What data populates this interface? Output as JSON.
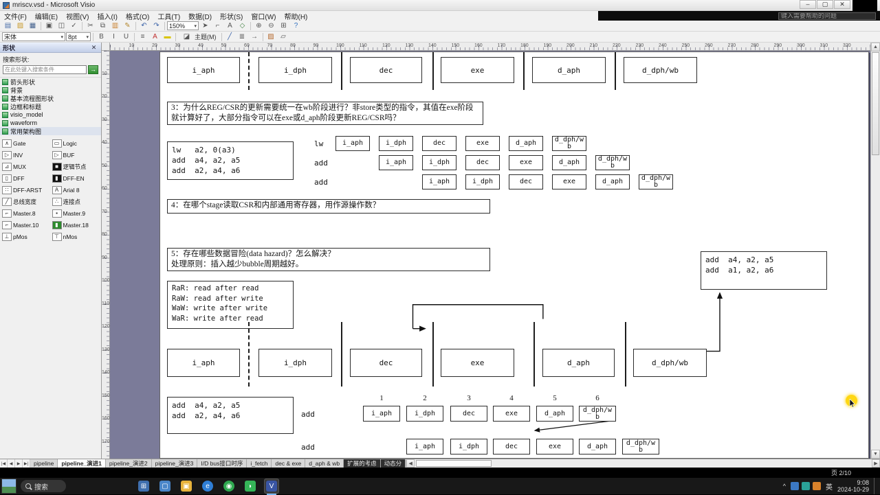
{
  "window": {
    "title": "mriscv.vsd - Microsoft Visio",
    "minimize": "–",
    "maximize": "▢",
    "close": "✕"
  },
  "menu_bar": {
    "items": [
      "文件(F)",
      "编辑(E)",
      "视图(V)",
      "插入(I)",
      "格式(O)",
      "工具(T)",
      "数据(D)",
      "形状(S)",
      "窗口(W)",
      "帮助(H)"
    ],
    "help_search": "键入需要帮助的问题"
  },
  "toolbars": {
    "zoom": "150%",
    "font_name": "宋体",
    "font_size": "8pt",
    "row1_icons": [
      {
        "n": "new-document-icon",
        "g": "▤",
        "c": "#4a6ea9"
      },
      {
        "n": "open-folder-icon",
        "g": "▨",
        "c": "#c99b2f"
      },
      {
        "n": "save-icon",
        "g": "▦",
        "c": "#44628e"
      },
      {
        "n": "print-icon",
        "g": "▣"
      },
      {
        "n": "print-preview-icon",
        "g": "◫"
      },
      {
        "n": "spelling-icon",
        "g": "✓"
      },
      {
        "n": "cut-icon",
        "g": "✂"
      },
      {
        "n": "copy-icon",
        "g": "⧉"
      },
      {
        "n": "paste-icon",
        "g": "▥",
        "c": "#c9812f"
      },
      {
        "n": "format-painter-icon",
        "g": "✎",
        "c": "#b3862c"
      },
      {
        "n": "undo-icon",
        "g": "↶",
        "c": "#3a62a8"
      },
      {
        "n": "redo-icon",
        "g": "↷",
        "c": "#3a62a8"
      },
      {
        "n": "zoom-level-select",
        "select": "zoom"
      },
      {
        "n": "pointer-tool-icon",
        "g": "➤"
      },
      {
        "n": "connector-tool-icon",
        "g": "⌐"
      },
      {
        "n": "text-tool-icon",
        "g": "A"
      },
      {
        "n": "drawing-tools-icon",
        "g": "◇",
        "c": "#3f7f3f"
      },
      {
        "n": "zoom-in-icon",
        "g": "⊕"
      },
      {
        "n": "zoom-out-icon",
        "g": "⊖"
      },
      {
        "n": "pan-icon",
        "g": "⊞"
      },
      {
        "n": "help-icon",
        "g": "?",
        "c": "#2f6fbf"
      }
    ],
    "row2_icons": [
      {
        "n": "bold-icon",
        "g": "B"
      },
      {
        "n": "italic-icon",
        "g": "I"
      },
      {
        "n": "underline-icon",
        "g": "U"
      },
      {
        "n": "align-left-icon",
        "g": "≡"
      },
      {
        "n": "font-color-icon",
        "g": "A",
        "c": "#c03030"
      },
      {
        "n": "highlighter-icon",
        "g": "▬",
        "c": "#d9c400"
      },
      {
        "n": "theme-button",
        "text": "主题(M)"
      },
      {
        "n": "line-color-icon",
        "g": "╱",
        "c": "#3a62a8"
      },
      {
        "n": "line-weight-icon",
        "g": "≣"
      },
      {
        "n": "arrow-ends-icon",
        "g": "→"
      },
      {
        "n": "fill-color-icon",
        "g": "▨",
        "c": "#b56a2f"
      },
      {
        "n": "shadow-icon",
        "g": "▱"
      }
    ]
  },
  "shapes_panel": {
    "title": "形状",
    "close": "✕",
    "search_label": "搜索形状:",
    "search_placeholder": "在此处键入搜索条件",
    "search_go": "→",
    "categories": [
      {
        "label": "箭头形状"
      },
      {
        "label": "背景"
      },
      {
        "label": "基本流程图形状"
      },
      {
        "label": "边框和标题"
      },
      {
        "label": "visio_model"
      },
      {
        "label": "waveform"
      },
      {
        "label": "常用架构图",
        "open": true
      }
    ],
    "stencil_items": [
      {
        "label": "Gate",
        "icon": "and-gate-icon",
        "g": "∧"
      },
      {
        "label": "Logic",
        "icon": "logic-block-icon",
        "g": "▭"
      },
      {
        "label": "INV",
        "icon": "inverter-icon",
        "g": "▷"
      },
      {
        "label": "BUF",
        "icon": "buffer-icon",
        "g": "▷"
      },
      {
        "label": "MUX",
        "icon": "mux-icon",
        "g": "⊿"
      },
      {
        "label": "逻辑节点",
        "icon": "logic-node-icon",
        "g": "■",
        "c": "#111"
      },
      {
        "label": "DFF",
        "icon": "dff-icon",
        "g": "▯"
      },
      {
        "label": "DFF-EN",
        "icon": "dff-en-icon",
        "g": "▮",
        "c": "#111"
      },
      {
        "label": "DFF-ARST",
        "icon": "dff-arst-icon",
        "g": "∷"
      },
      {
        "label": "Arial 8",
        "icon": "text-style-icon",
        "g": "A"
      },
      {
        "label": "总线宽度",
        "icon": "bus-width-icon",
        "g": "╱"
      },
      {
        "label": "连接点",
        "icon": "connect-point-icon",
        "g": "∴"
      },
      {
        "label": "Master.8",
        "icon": "master8-icon",
        "g": "⌐"
      },
      {
        "label": "Master.9",
        "icon": "master9-icon",
        "g": "▪"
      },
      {
        "label": "Master.10",
        "icon": "master10-icon",
        "g": "⌐"
      },
      {
        "label": "Master.18",
        "icon": "master18-icon",
        "g": "▮",
        "c": "#2e8b2e"
      },
      {
        "label": "pMos",
        "icon": "pmos-icon",
        "g": "⊥"
      },
      {
        "label": "nMos",
        "icon": "nmos-icon",
        "g": "⊤"
      }
    ]
  },
  "rulers": {
    "start": 10,
    "step": 10,
    "h_count": 32,
    "v_count": 17
  },
  "canvas": {
    "stages": [
      "i_aph",
      "i_dph",
      "dec",
      "exe",
      "d_aph",
      "d_dph/wb"
    ],
    "q3": "3：为什么REG/CSR的更新需要统一在wb阶段进行？非store类型的指令，其值在exe阶段就计算好了，大部分指令可以在exe或d_aph阶段更新REG/CSR吗？",
    "q4": "4：在哪个stage读取CSR和内部通用寄存器，用作源操作数？",
    "q5": "5：存在哪些数据冒险(data hazard)？怎么解决？\n处理原则：插入越少bubble周期越好。",
    "code_lw": "lw   a2, 0(a3)\nadd  a4, a2, a5\nadd  a2, a4, a6",
    "hazards": "RaR: read after read\nRaW: read after write\nWaW: write after write\nWaR: write after read",
    "code_add_right": "add  a4, a2, a5\nadd  a1, a2, a6",
    "code_add_bottom": "add  a4, a2, a5\nadd  a2, a4, a6",
    "pipe1_rows": [
      {
        "label": "lw",
        "start": 0
      },
      {
        "label": "add",
        "start": 1
      },
      {
        "label": "add",
        "start": 2
      }
    ],
    "pipe2_numbers": [
      "1",
      "2",
      "3",
      "4",
      "5",
      "6"
    ],
    "pipe2_rows": [
      {
        "label": "add",
        "start": 0
      },
      {
        "label": "add",
        "start": 1
      }
    ]
  },
  "sheet_tabs": {
    "nav": [
      "|◀",
      "◀",
      "▶",
      "▶|"
    ],
    "tabs": [
      {
        "label": "pipeline"
      },
      {
        "label": "pipeline_演进1",
        "active": true
      },
      {
        "label": "pipeline_演进2"
      },
      {
        "label": "pipeline_演进3"
      },
      {
        "label": "I/D bus接口时序"
      },
      {
        "label": "i_fetch"
      },
      {
        "label": "dec & exe"
      },
      {
        "label": "d_aph & wb"
      },
      {
        "label": "扩展的考虑",
        "dark": true
      },
      {
        "label": "动态分",
        "dark": true
      }
    ]
  },
  "status_bar": {
    "page_indicator": "页 2/10"
  },
  "taskbar": {
    "search_label": "搜索",
    "apps": [
      {
        "n": "task-view-icon",
        "bg": "#3f6fae",
        "g": "⊞"
      },
      {
        "n": "remote-desktop-icon",
        "bg": "#4a86c8",
        "g": "▢"
      },
      {
        "n": "file-explorer-icon",
        "bg": "#e8b33c",
        "g": "▣"
      },
      {
        "n": "edge-browser-icon",
        "bg": "#2f7fd6",
        "g": "e",
        "round": true
      },
      {
        "n": "app-store-icon",
        "bg": "#2fa84f",
        "g": "◉",
        "round": true
      },
      {
        "n": "wechat-icon",
        "bg": "#35b558",
        "g": "◗"
      },
      {
        "n": "visio-taskbar-icon",
        "bg": "#3955a3",
        "g": "V",
        "active": true
      }
    ],
    "tray": {
      "expand": "^",
      "icons": [
        {
          "n": "tray-icon-blue",
          "bg": "#3b78c3"
        },
        {
          "n": "tray-icon-teal",
          "bg": "#2aa198"
        },
        {
          "n": "tray-icon-orange",
          "bg": "#d9822b"
        }
      ],
      "ime": "英",
      "time": "9:08",
      "date": "2024-10-29"
    }
  }
}
